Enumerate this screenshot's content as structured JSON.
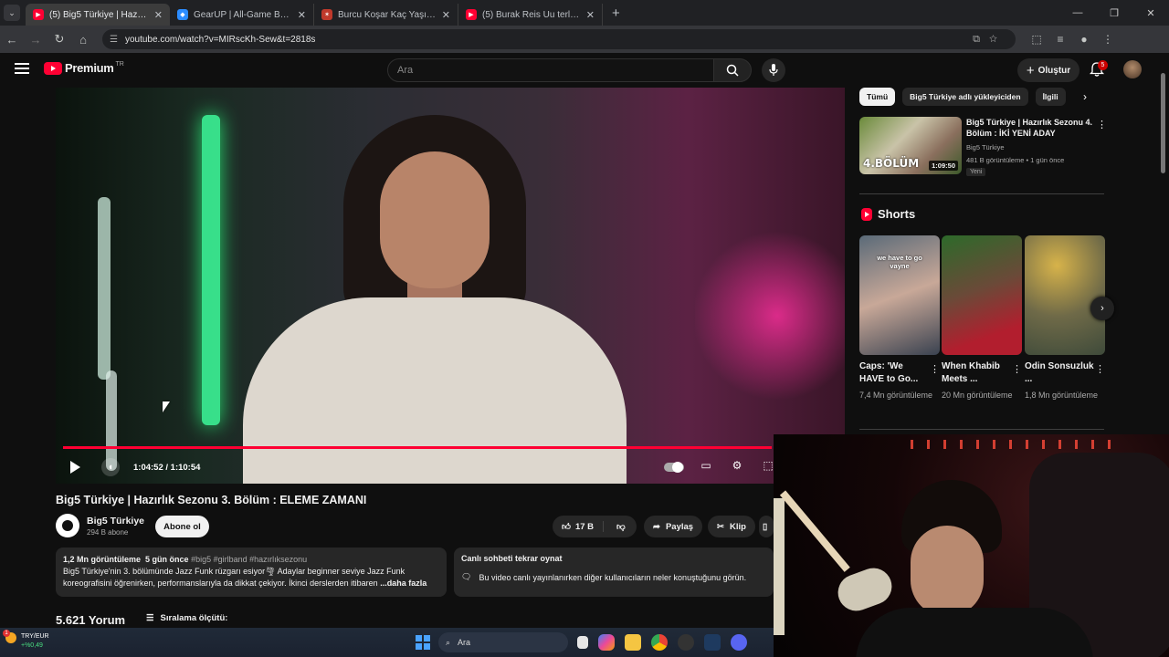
{
  "browser": {
    "tabs": [
      {
        "title": "(5) Big5 Türkiye | Hazırlık Sezonu",
        "active": true,
        "favicon": "youtube-icon",
        "color": "#ff0033"
      },
      {
        "title": "GearUP | All-Game Booster | Re",
        "active": false,
        "favicon": "gearup-icon",
        "color": "#2b8cff"
      },
      {
        "title": "Burcu Koşar Kaç Yaşında? Big 5",
        "active": false,
        "favicon": "site-icon",
        "color": "#c0392b"
      },
      {
        "title": "(5) Burak Reis Uu terliyorum - Yo",
        "active": false,
        "favicon": "youtube-icon",
        "color": "#ff0033"
      }
    ],
    "url": "youtube.com/watch?v=MIRscKh-Sew&t=2818s"
  },
  "header": {
    "logo": "Premium",
    "country": "TR",
    "search_placeholder": "Ara",
    "create_label": "Oluştur",
    "notification_count": "5"
  },
  "player": {
    "time": "1:04:52 / 1:10:54",
    "progress": 0.915
  },
  "video": {
    "title": "Big5 Türkiye | Hazırlık Sezonu 3. Bölüm : ELEME ZAMANI",
    "channel": "Big5 Türkiye",
    "subscribers": "294 B abone",
    "subscribe_label": "Abone ol",
    "likes": "17 B",
    "share_label": "Paylaş",
    "clip_label": "Klip"
  },
  "description": {
    "views": "1,2 Mn görüntüleme",
    "age": "5 gün önce",
    "tags": "#big5 #girlband #hazırlıksezonu",
    "line1": "Big5 Türkiye'nin 3. bölümünde Jazz Funk rüzgarı esiyor🌪 Adaylar beginner seviye Jazz Funk",
    "line2": "koreografisini öğrenirken, performanslarıyla da dikkat çekiyor. İkinci derslerden itibaren",
    "more": "...daha fazla"
  },
  "chat": {
    "title": "Canlı sohbeti tekrar oynat",
    "text": "Bu video canlı yayınlanırken diğer kullanıcıların neler konuştuğunu görün."
  },
  "comments": {
    "count": "5.621 Yorum",
    "sort_label": "Sıralama ölçütü:"
  },
  "sidebar": {
    "chips": [
      "Tümü",
      "Big5 Türkiye adlı yükleyiciden",
      "İlgili"
    ],
    "recommended": {
      "title": "Big5 Türkiye | Hazırlık Sezonu 4. Bölüm : İKİ YENİ ADAY",
      "channel": "Big5 Türkiye",
      "meta": "481 B görüntüleme • 1 gün önce",
      "badge": "Yeni",
      "duration": "1:09:50",
      "thumb_text": "4.BÖLÜM"
    },
    "shorts_heading": "Shorts",
    "shorts": [
      {
        "title": "Caps: 'We HAVE to Go...",
        "views": "7,4 Mn görüntüleme",
        "caption": "we have to go vayne"
      },
      {
        "title": "When Khabib Meets ...",
        "views": "20 Mn görüntüleme",
        "caption": ""
      },
      {
        "title": "Odin Sonsuzluk ...",
        "views": "1,8 Mn görüntüleme",
        "caption": ""
      }
    ]
  },
  "taskbar": {
    "currency": "TRY/EUR",
    "change": "+%0,49",
    "alert_count": "1",
    "search_label": "Ara"
  }
}
